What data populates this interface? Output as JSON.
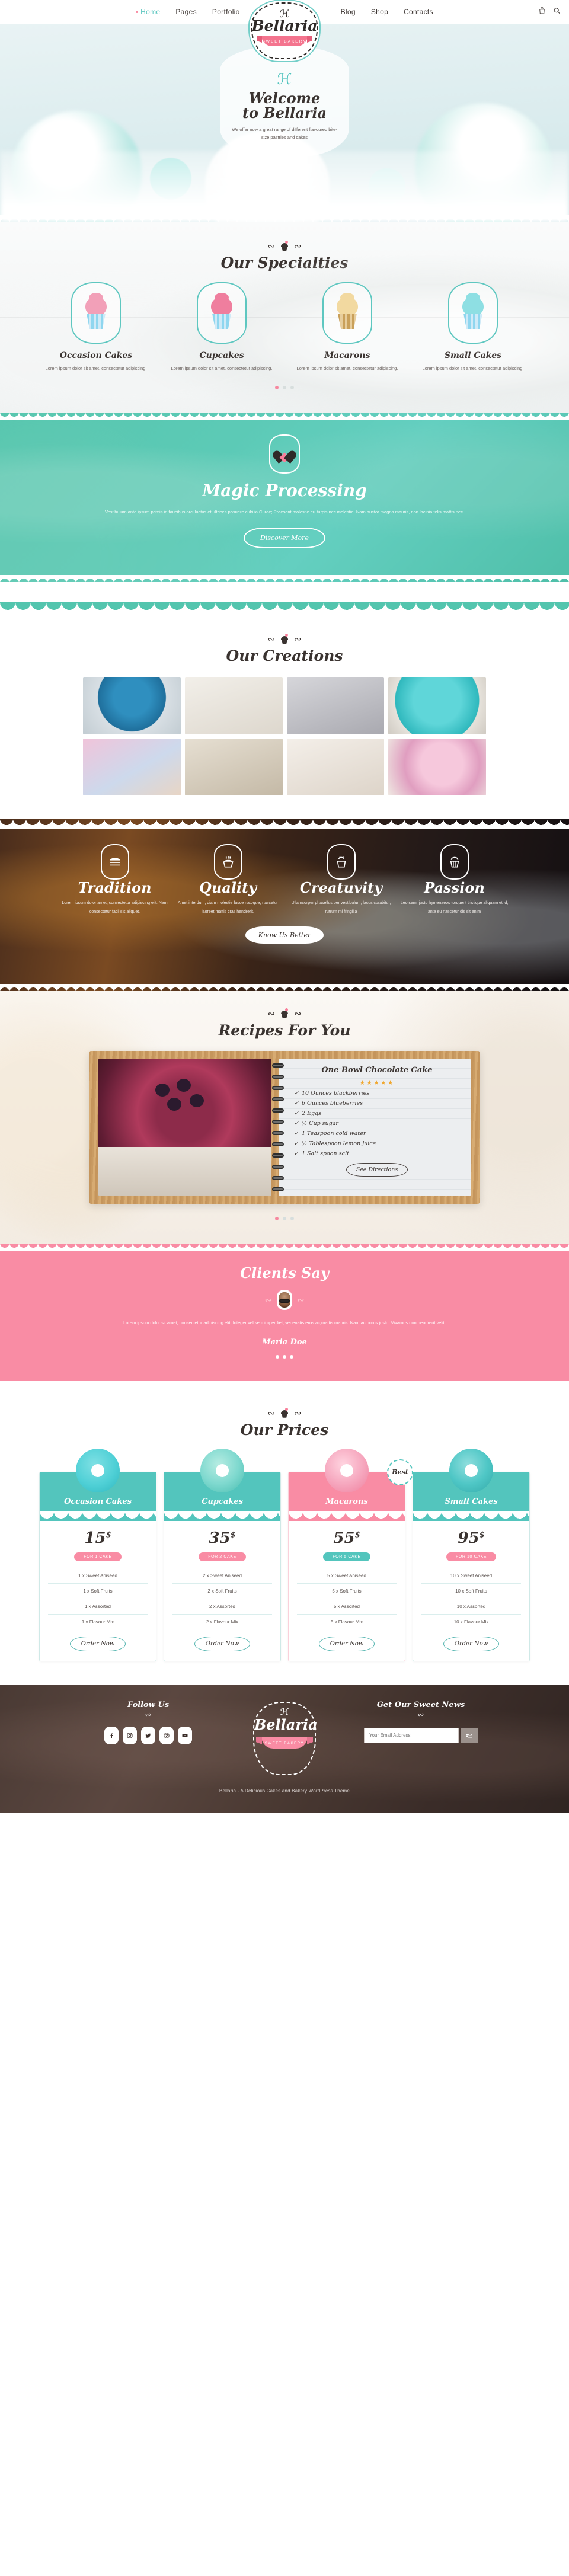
{
  "header": {
    "nav": [
      {
        "label": "Home",
        "active": true
      },
      {
        "label": "Pages",
        "active": false
      },
      {
        "label": "Portfolio",
        "active": false
      },
      {
        "label": "Blog",
        "active": false
      },
      {
        "label": "Shop",
        "active": false
      },
      {
        "label": "Contacts",
        "active": false
      }
    ],
    "cart_icon": "bag-icon",
    "search_icon": "search-icon"
  },
  "logo": {
    "name": "Bellaria",
    "ribbon": "SWEET BAKERY",
    "swirl": "℈"
  },
  "hero": {
    "title_line1": "Welcome",
    "title_line2": "to Bellaria",
    "subtitle": "We offer now a great range of different flavoured bite-size pastries and cakes"
  },
  "specialties": {
    "title": "Our Specialties",
    "items": [
      {
        "name": "Occasion Cakes",
        "desc": "Lorem ipsum dolor sit amet, consectetur adipiscing.",
        "frost": "#f2a0b8",
        "topper": "#f77f9b"
      },
      {
        "name": "Cupcakes",
        "desc": "Lorem ipsum dolor sit amet, consectetur adipiscing.",
        "frost": "#ef7e9e",
        "topper": "#d0283c"
      },
      {
        "name": "Macarons",
        "desc": "Lorem ipsum dolor sit amet, consectetur adipiscing.",
        "frost": "#f2d9a0",
        "topper": "#e8c37a"
      },
      {
        "name": "Small Cakes",
        "desc": "Lorem ipsum dolor sit amet, consectetur adipiscing.",
        "frost": "#8edfe3",
        "topper": "#f4a9c0"
      }
    ],
    "dots": [
      "on",
      "off",
      "off"
    ]
  },
  "magic": {
    "title": "Magic Processing",
    "text": "Vestibulum ante ipsum primis in faucibus orci luctus et ultrices posuere cubilia Curae; Praesent molestie eu turpis nec molestie. Nam auctor magna mauris, non lacinia felis mattis nec.",
    "button": "Discover More"
  },
  "creations": {
    "title": "Our Creations",
    "tiles": [
      "#2f8fbf",
      "#e8e4de",
      "#bfbfc4",
      "#37c0c4",
      "#e3b9d4",
      "#d8d2c4",
      "#efe9e2",
      "#e6b7cf"
    ]
  },
  "features": {
    "items": [
      {
        "name": "Tradition",
        "desc": "Lorem ipsum dolor amet, consectetur adipiscing elit. Nam consectetur facilisis aliquet.",
        "icon": "cake-layers-icon"
      },
      {
        "name": "Quality",
        "desc": "Amet interdum, diam molestie fusce natoque, nascetur laoreet mattis cras hendrerit.",
        "icon": "hot-muffin-icon"
      },
      {
        "name": "Creatuvity",
        "desc": "Ullamcorper phasellus per vestibulum, lacus curabitur, rutrum mi fringilla",
        "icon": "frosted-cupcake-icon"
      },
      {
        "name": "Passion",
        "desc": "Leo sem, justo hymenaeos torquent tristique aliquam et id, ante eu nascetur dis sit enim",
        "icon": "cupcake-icon"
      }
    ],
    "button": "Know Us Better"
  },
  "recipes": {
    "title": "Recipes For You",
    "recipe_title": "One Bowl Chocolate Cake",
    "stars": "★★★★★",
    "ingredients": [
      "10 Ounces blackberries",
      "6  Ounces blueberries",
      "2 Eggs",
      "½ Cup sugar",
      "1  Teaspoon cold water",
      "½ Tablespoon lemon juice",
      "1  Salt spoon salt"
    ],
    "check": "✓",
    "button": "See Directions",
    "dots": [
      "on",
      "off",
      "off"
    ]
  },
  "testimonial": {
    "title": "Clients Say",
    "text": "Lorem ipsum dolor sit amet, consectetur adipiscing elit. Integer vel sem imperdiet, venenatis eros ac,mattis mauris. Nam ac purus justo. Vivamus non hendrerit velit.",
    "author": "Maria Doe",
    "dots": [
      "on",
      "on",
      "on"
    ]
  },
  "prices": {
    "title": "Our Prices",
    "best_label": "Best",
    "cards": [
      {
        "category": "Occasion Cakes",
        "price": "15",
        "currency": "$",
        "tag": "FOR 1 CAKE",
        "tag_color": "pink",
        "theme": "teal",
        "donut": "#4fd0d6",
        "donut2": "#2fb6bd",
        "features": [
          "1 x Sweet Aniseed",
          "1 x Soft Fruits",
          "1 x Assorted",
          "1 x Flavour Mix"
        ],
        "button": "Order Now",
        "best": false
      },
      {
        "category": "Cupcakes",
        "price": "35",
        "currency": "$",
        "tag": "FOR 2 CAKE",
        "tag_color": "pink",
        "theme": "teal",
        "donut": "#7fd9cf",
        "donut2": "#48bdb0",
        "features": [
          "2 x Sweet Aniseed",
          "2 x Soft Fruits",
          "2 x Assorted",
          "2 x Flavour Mix"
        ],
        "button": "Order Now",
        "best": false
      },
      {
        "category": "Macarons",
        "price": "55",
        "currency": "$",
        "tag": "FOR 5 CAKE",
        "tag_color": "teal",
        "theme": "pink",
        "donut": "#f6a8bf",
        "donut2": "#ef7f9d",
        "features": [
          "5 x Sweet Aniseed",
          "5 x Soft Fruits",
          "5 x Assorted",
          "5 x Flavour Mix"
        ],
        "button": "Order Now",
        "best": true
      },
      {
        "category": "Small Cakes",
        "price": "95",
        "currency": "$",
        "tag": "FOR 10 CAKE",
        "tag_color": "pink",
        "theme": "teal",
        "donut": "#4fc7c6",
        "donut2": "#33a9a8",
        "features": [
          "10 x Sweet Aniseed",
          "10 x Soft Fruits",
          "10 x Assorted",
          "10 x Flavour Mix"
        ],
        "button": "Order Now",
        "best": false
      }
    ]
  },
  "footer": {
    "follow_title": "Follow Us",
    "news_title": "Get Our Sweet News",
    "email_placeholder": "Your Email Address",
    "submit_icon": "send-mail-icon",
    "socials": [
      "facebook-icon",
      "instagram-icon",
      "twitter-icon",
      "pinterest-icon",
      "youtube-icon"
    ],
    "copyright": "Bellaria - A Delicious Cakes and Bakery WordPress Theme"
  }
}
